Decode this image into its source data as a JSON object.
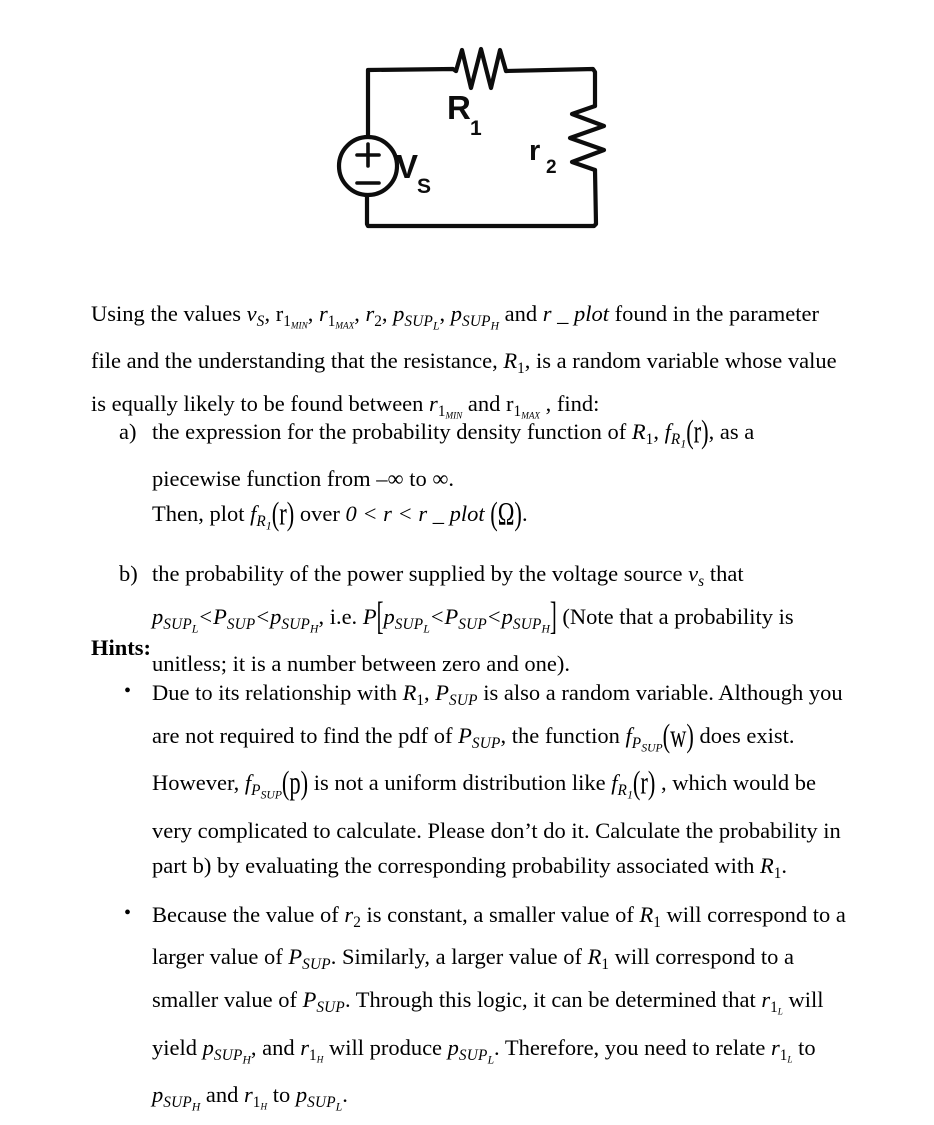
{
  "document": {
    "figure": {
      "name": "series-circuit-schematic",
      "description": "Hand-drawn series circuit: voltage source v_S in series with resistor R_1 and resistor r_2",
      "labels": {
        "source": "V",
        "source_sub": "S",
        "source_plus": "+",
        "source_minus": "−",
        "resistor1": "R",
        "resistor1_sub": "1",
        "resistor2": "r",
        "resistor2_sub": "2"
      }
    },
    "intro": {
      "line1_a": "Using the values ",
      "v": "v",
      "v_sub": "S",
      "comma1": ", ",
      "r_upright": "r",
      "r1": "1",
      "min": "MIN",
      "comma2": ", ",
      "r_italic": "r",
      "max": "MAX",
      "comma3": ", ",
      "r2": "r",
      "r2_sub": "2",
      "comma4": ", ",
      "p": "p",
      "sup": "SUP",
      "L": "L",
      "comma5": ", ",
      "H": "H",
      "and": " and ",
      "r_plot": "r _ plot",
      "line1_b": " found in the parameter file",
      "line2_a": "and the understanding that the resistance, ",
      "R": "R",
      "R_sub": "1",
      "line2_b": ", is a random variable whose value is",
      "line3_a": "equally likely to be found between ",
      "line3_mid": " and ",
      "line3_b": " , find:"
    },
    "questions": [
      {
        "marker": "a)",
        "segments": {
          "t1": "the expression for the probability density function of ",
          "R": "R",
          "R_sub": "1",
          "t2": ",  ",
          "f": "f",
          "f_sub_R": "R",
          "f_sub_1": "1",
          "arg": "(r)",
          "t3": ", as a",
          "t4": "piecewise function from ",
          "neg_inf": "–∞",
          "t5": " to ",
          "inf": "∞",
          "t6": ".",
          "t7": "Then, plot ",
          "t8": " over ",
          "range": "0 < r < r _ plot",
          "ohm": "(Ω)",
          "t9": "."
        }
      },
      {
        "marker": "b)",
        "segments": {
          "t1": "the probability of the power supplied by the voltage source ",
          "vs": "v",
          "vs_sub": "s",
          "t2": " that",
          "ineq_p": "p",
          "ineq_sub_low": "SUP",
          "ineq_sub_L": "L",
          "lt": "<",
          "P": "P",
          "P_sub": "SUP",
          "ineq_sub_H": "H",
          "t3": ", i.e. ",
          "Pbig": "P",
          "t4": " (Note that a probability is",
          "t5": "unitless; it is a number between zero and one)."
        }
      }
    ],
    "hints_heading": "Hints:",
    "hints": [
      {
        "segments": {
          "t1": "Due to its relationship with ",
          "R": "R",
          "R_sub": "1",
          "t2": ",  ",
          "P": "P",
          "P_sub": "SUP",
          "t3": " is also a random variable. Although you",
          "t4": "are not required to find the pdf of ",
          "t5": ", the function ",
          "f": "f",
          "f_sub_P": "P",
          "f_sub_SUP": "SUP",
          "arg_w": "(w)",
          "t6": " does exist.",
          "t7": "However, ",
          "arg_p": "(p)",
          "t8": " is not a uniform distribution like ",
          "arg_r": "(r)",
          "t9": " , which would be",
          "t10": "very complicated to calculate. Please don’t do it. Calculate the probability in",
          "t11": "part b) by evaluating the corresponding probability associated with ",
          "t12": "."
        }
      },
      {
        "segments": {
          "t1": "Because the value of ",
          "r2": "r",
          "r2_sub": "2",
          "t2": " is constant, a smaller value of ",
          "R": "R",
          "R_sub": "1",
          "t3": " will correspond to a",
          "t4": "larger value of ",
          "P": "P",
          "P_sub": "SUP",
          "t5": ". Similarly, a larger value of ",
          "t6": " will correspond to a",
          "t7": "smaller value of ",
          "t8": ". Through this logic, it can be determined that ",
          "r1L": "r",
          "r1L_1": "1",
          "r1L_L": "L",
          "t9": " will",
          "t10": "yield ",
          "p": "p",
          "p_sub": "SUP",
          "p_sub_H": "H",
          "t11": ", and ",
          "r1H_L": "H",
          "t12": " will produce ",
          "p_sub_L": "L",
          "t13": ". Therefore, you need to relate ",
          "t14": " to",
          "t15": " and ",
          "t16": " to ",
          "t17": "."
        }
      }
    ],
    "bullet_glyph": "•",
    "colors": {
      "text": "#000000",
      "background": "#ffffff",
      "ink": "#0d0d0d"
    }
  }
}
